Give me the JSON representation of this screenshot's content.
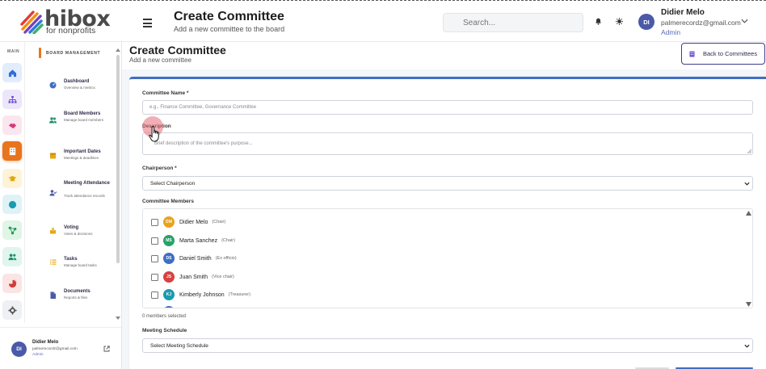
{
  "brand": {
    "name": "hibox",
    "tagline": "for nonprofits"
  },
  "header": {
    "title": "Create Committee",
    "subtitle": "Add a new committee to the board",
    "search_placeholder": "Search...",
    "user": {
      "initials": "DI",
      "name": "Didier Melo",
      "email": "palmerecordz@gmail.com",
      "role": "Admin"
    }
  },
  "rail": {
    "label": "MAIN",
    "items": [
      {
        "icon": "home-icon",
        "bg": "#e3ecfb",
        "color": "#2f6fd6"
      },
      {
        "icon": "sitemap-icon",
        "bg": "#ece6fa",
        "color": "#6b4fd0"
      },
      {
        "icon": "handshake-icon",
        "bg": "#fbe5ee",
        "color": "#d63a78"
      },
      {
        "icon": "building-icon",
        "bg": "#e8741e",
        "color": "#ffffff"
      },
      {
        "icon": "graduation-cap-icon",
        "bg": "#fdf3d6",
        "color": "#e5a712"
      },
      {
        "icon": "globe-icon",
        "bg": "#dff3f7",
        "color": "#1a9bb0"
      },
      {
        "icon": "network-icon",
        "bg": "#e0f5e6",
        "color": "#27995a"
      },
      {
        "icon": "users-icon",
        "bg": "#e0f5ee",
        "color": "#1d8f6b"
      },
      {
        "icon": "pie-chart-icon",
        "bg": "#fbe4e4",
        "color": "#d23a3a"
      },
      {
        "icon": "gear-icon",
        "bg": "#eef0f3",
        "color": "#555555"
      }
    ]
  },
  "nav": {
    "heading": "BOARD MANAGEMENT",
    "items": [
      {
        "title": "Dashboard",
        "desc": "Overview & metrics",
        "icon": "gauge-icon"
      },
      {
        "title": "Board Members",
        "desc": "Manage board members",
        "icon": "users-icon"
      },
      {
        "title": "Important Dates",
        "desc": "Meetings & deadlines",
        "icon": "calendar-icon"
      },
      {
        "title": "Meeting Attendance",
        "desc": "Track attendance records",
        "icon": "user-check-icon"
      },
      {
        "title": "Voting",
        "desc": "Votes & decisions",
        "icon": "ballot-icon"
      },
      {
        "title": "Tasks",
        "desc": "Manage board tasks",
        "icon": "list-icon"
      },
      {
        "title": "Documents",
        "desc": "Reports & files",
        "icon": "file-icon"
      }
    ],
    "footer": {
      "initials": "DI",
      "name": "Didier Melo",
      "email": "palmerecordz@gmail.com",
      "role": "Admin"
    }
  },
  "main": {
    "title": "Create Committee",
    "subtitle": "Add a new committee",
    "back_label": "Back to Committees",
    "form": {
      "name_label": "Committee Name *",
      "name_placeholder": "e.g., Finance Committee, Governance Committee",
      "desc_label": "Description",
      "desc_placeholder": "Brief description of the committee's purpose...",
      "chair_label": "Chairperson *",
      "chair_value": "Select Chairperson",
      "members_label": "Committee Members",
      "members": [
        {
          "initials": "DM",
          "name": "Didier Melo",
          "role": "(Chair)",
          "color": "#e8a21e"
        },
        {
          "initials": "MS",
          "name": "Marta Sanchez",
          "role": "(Chair)",
          "color": "#27a36a"
        },
        {
          "initials": "DS",
          "name": "Daniel Smith",
          "role": "(Ex officio)",
          "color": "#3f6ec4"
        },
        {
          "initials": "JS",
          "name": "Juan Smith",
          "role": "(Vice chair)",
          "color": "#d74242"
        },
        {
          "initials": "KJ",
          "name": "Kimberly Johnson",
          "role": "(Treasurer)",
          "color": "#1a9bb0"
        }
      ],
      "selected_count": "0 members selected",
      "schedule_label": "Meeting Schedule",
      "schedule_value": "Select Meeting Schedule"
    }
  }
}
